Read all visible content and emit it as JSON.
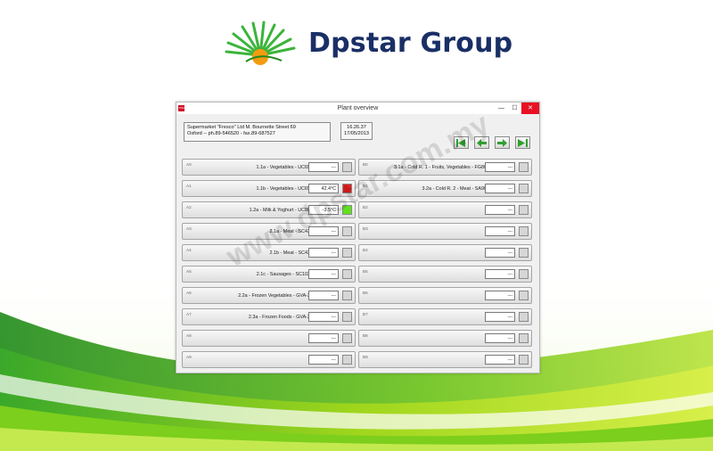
{
  "brand": {
    "name": "Dpstar Group"
  },
  "window": {
    "title": "Plant overview",
    "app_icon_text": "TOM",
    "controls": {
      "minimize": "—",
      "maximize": "☐",
      "close": "✕"
    }
  },
  "info": {
    "line1": "Supermarket \"Fresco\" Ltd  M. Bournette Street 69",
    "line2": "Oxford  --  ph.89-546520 - fax.89-687527"
  },
  "clock": {
    "time": "16.26.37",
    "date": "17/05/2013"
  },
  "nav_buttons": [
    "first-icon",
    "prev-icon",
    "next-icon",
    "last-icon"
  ],
  "colors": {
    "alarm": "#e31e1e",
    "ok": "#5fe21d",
    "none": "#d6d6d6"
  },
  "left_slots": [
    {
      "code": "A0",
      "label": "1.1a - Vegetables - UC65",
      "value": "---",
      "status": "none"
    },
    {
      "code": "A1",
      "label": "1.1b - Vegetables - UC65",
      "value": "42.4°C",
      "status": "alarm"
    },
    {
      "code": "A2",
      "label": "1.2a - Milk & Yoghurt - UC80",
      "value": "-3.5°C",
      "status": "ok"
    },
    {
      "code": "A3",
      "label": "2.1a - Meat - SC43",
      "value": "---",
      "status": "none"
    },
    {
      "code": "A4",
      "label": "2.1b - Meat - SC43",
      "value": "---",
      "status": "none"
    },
    {
      "code": "A5",
      "label": "2.1c - Sausages - SC102",
      "value": "---",
      "status": "none"
    },
    {
      "code": "A6",
      "label": "2.2a - Frozen Vegetables - GVA-2",
      "value": "---",
      "status": "none"
    },
    {
      "code": "A7",
      "label": "2.3a - Frozen Foods - GVA-2",
      "value": "---",
      "status": "none"
    },
    {
      "code": "A8",
      "label": "",
      "value": "---",
      "status": "none"
    },
    {
      "code": "A9",
      "label": "",
      "value": "---",
      "status": "none"
    }
  ],
  "right_slots": [
    {
      "code": "B0",
      "label": "3.1a - Cold R. 1 - Fruits, Vegetables - FG80",
      "value": "---",
      "status": "none"
    },
    {
      "code": "B1",
      "label": "3.2a - Cold R. 2 - Meat - SA90",
      "value": "---",
      "status": "none"
    },
    {
      "code": "B2",
      "label": "",
      "value": "---",
      "status": "none"
    },
    {
      "code": "B3",
      "label": "",
      "value": "---",
      "status": "none"
    },
    {
      "code": "B4",
      "label": "",
      "value": "---",
      "status": "none"
    },
    {
      "code": "B5",
      "label": "",
      "value": "---",
      "status": "none"
    },
    {
      "code": "B6",
      "label": "",
      "value": "---",
      "status": "none"
    },
    {
      "code": "B7",
      "label": "",
      "value": "---",
      "status": "none"
    },
    {
      "code": "B8",
      "label": "",
      "value": "---",
      "status": "none"
    },
    {
      "code": "B9",
      "label": "",
      "value": "---",
      "status": "none"
    }
  ],
  "watermark": {
    "text": "www.dpstar.com.my"
  }
}
